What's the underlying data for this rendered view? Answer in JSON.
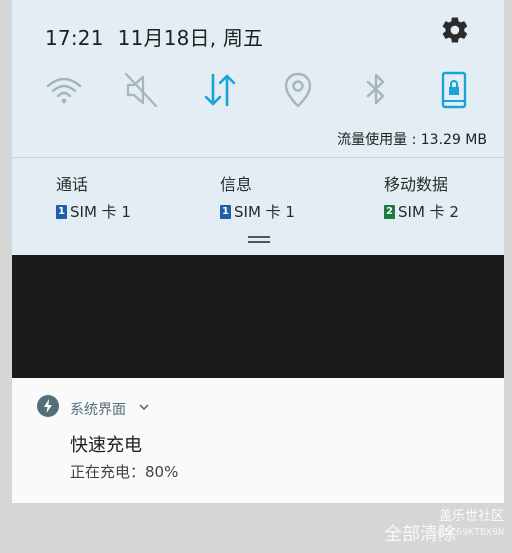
{
  "status": {
    "time": "17:21",
    "date": "11月18日, 周五"
  },
  "quick_settings": [
    {
      "icon": "wifi-icon",
      "state": "off"
    },
    {
      "icon": "mute-icon",
      "state": "off"
    },
    {
      "icon": "mobile-data-icon",
      "state": "on"
    },
    {
      "icon": "location-icon",
      "state": "off"
    },
    {
      "icon": "bluetooth-icon",
      "state": "off"
    },
    {
      "icon": "screen-lock-icon",
      "state": "on"
    }
  ],
  "usage": "流量使用量 : 13.29 MB",
  "sim_settings": [
    {
      "title": "通话",
      "sim_number": "1",
      "sim_label": "SIM 卡 1"
    },
    {
      "title": "信息",
      "sim_number": "1",
      "sim_label": "SIM 卡 1"
    },
    {
      "title": "移动数据",
      "sim_number": "2",
      "sim_label": "SIM 卡 2"
    }
  ],
  "notification": {
    "app_name": "系统界面",
    "title": "快速充电",
    "text": "正在充电：80%"
  },
  "clear_all": "全部清除",
  "watermark": {
    "line1": "盖乐世社区",
    "line2": "@SC69KTBX9N"
  },
  "colors": {
    "panel": "#e2eef4",
    "accent": "#1aa3d6",
    "icon_off": "#a8b4bb",
    "sim1": "#1f5fa8",
    "sim2": "#1b7a3e"
  }
}
